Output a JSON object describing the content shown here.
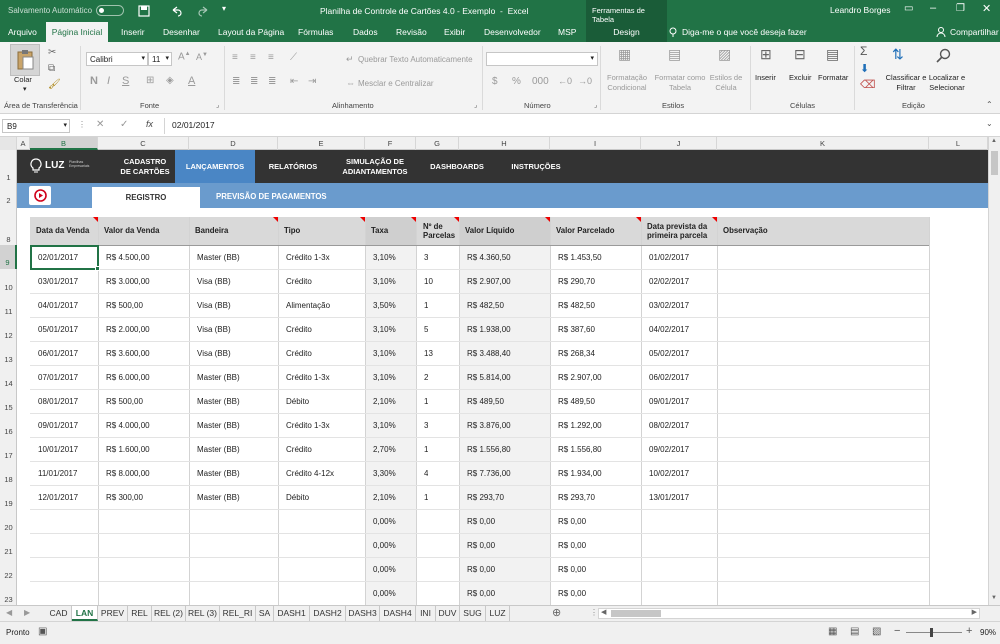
{
  "titlebar": {
    "autosave_label": "Salvamento Automático",
    "autosave_state": "Desativado",
    "title": "Planilha de Controle de Cartões 4.0 - Exemplo  -  Excel",
    "context_tools": "Ferramentas de Tabela",
    "user": "Leandro Borges"
  },
  "ribbon_tabs": [
    "Arquivo",
    "Página Inicial",
    "Inserir",
    "Desenhar",
    "Layout da Página",
    "Fórmulas",
    "Dados",
    "Revisão",
    "Exibir",
    "Desenvolvedor",
    "MSP",
    "Design"
  ],
  "tell_me": "Diga-me o que você deseja fazer",
  "share": "Compartilhar",
  "ribbon": {
    "paste": "Colar",
    "clipboard": "Área de Transferência",
    "font_name": "Calibri",
    "font_size": "11",
    "bold": "N",
    "italic": "I",
    "underline": "S",
    "font_group": "Fonte",
    "wrap_text": "Quebrar Texto Automaticamente",
    "merge_center": "Mesclar e Centralizar",
    "alignment_group": "Alinhamento",
    "number_group": "Número",
    "cond_format": "Formatação Condicional",
    "format_table": "Formatar como Tabela",
    "cell_styles": "Estilos de Célula",
    "styles_group": "Estilos",
    "insert": "Inserir",
    "delete": "Excluir",
    "format": "Formatar",
    "cells_group": "Células",
    "sort_filter": "Classificar e Filtrar",
    "find_select": "Localizar e Selecionar",
    "editing_group": "Edição"
  },
  "formula_bar": {
    "name_box": "B9",
    "formula": "02/01/2017",
    "fx": "fx"
  },
  "columns": [
    "A",
    "B",
    "C",
    "D",
    "E",
    "F",
    "G",
    "H",
    "I",
    "J",
    "K",
    "L"
  ],
  "rows": [
    "1",
    "2",
    "8",
    "9",
    "10",
    "11",
    "12",
    "13",
    "14",
    "15",
    "16",
    "17",
    "18",
    "19",
    "20",
    "21",
    "22",
    "23"
  ],
  "nav": {
    "logo": "LUZ",
    "logo_sub": "Planilhas Empresariais",
    "items": [
      "CADASTRO\nDE CARTÕES",
      "LANÇAMENTOS",
      "RELATÓRIOS",
      "SIMULAÇÃO DE\nADIANTAMENTOS",
      "DASHBOARDS",
      "INSTRUÇÕES"
    ],
    "active_index": 1
  },
  "subtabs": [
    "REGISTRO",
    "PREVISÃO DE PAGAMENTOS"
  ],
  "table": {
    "headers": [
      "Data da Venda",
      "Valor da Venda",
      "Bandeira",
      "Tipo",
      "Taxa",
      "Nº de Parcelas",
      "Valor Líquido",
      "Valor Parcelado",
      "Data prevista da primeira parcela",
      "Observação"
    ],
    "rows": [
      [
        "02/01/2017",
        "R$ 4.500,00",
        "Master (BB)",
        "Crédito 1-3x",
        "3,10%",
        "3",
        "R$ 4.360,50",
        "R$ 1.453,50",
        "01/02/2017",
        ""
      ],
      [
        "03/01/2017",
        "R$ 3.000,00",
        "Visa (BB)",
        "Crédito",
        "3,10%",
        "10",
        "R$ 2.907,00",
        "R$ 290,70",
        "02/02/2017",
        ""
      ],
      [
        "04/01/2017",
        "R$ 500,00",
        "Visa (BB)",
        "Alimentação",
        "3,50%",
        "1",
        "R$ 482,50",
        "R$ 482,50",
        "03/02/2017",
        ""
      ],
      [
        "05/01/2017",
        "R$ 2.000,00",
        "Visa (BB)",
        "Crédito",
        "3,10%",
        "5",
        "R$ 1.938,00",
        "R$ 387,60",
        "04/02/2017",
        ""
      ],
      [
        "06/01/2017",
        "R$ 3.600,00",
        "Visa (BB)",
        "Crédito",
        "3,10%",
        "13",
        "R$ 3.488,40",
        "R$ 268,34",
        "05/02/2017",
        ""
      ],
      [
        "07/01/2017",
        "R$ 6.000,00",
        "Master (BB)",
        "Crédito 1-3x",
        "3,10%",
        "2",
        "R$ 5.814,00",
        "R$ 2.907,00",
        "06/02/2017",
        ""
      ],
      [
        "08/01/2017",
        "R$ 500,00",
        "Master (BB)",
        "Débito",
        "2,10%",
        "1",
        "R$ 489,50",
        "R$ 489,50",
        "09/01/2017",
        ""
      ],
      [
        "09/01/2017",
        "R$ 4.000,00",
        "Master (BB)",
        "Crédito 1-3x",
        "3,10%",
        "3",
        "R$ 3.876,00",
        "R$ 1.292,00",
        "08/02/2017",
        ""
      ],
      [
        "10/01/2017",
        "R$ 1.600,00",
        "Master (BB)",
        "Crédito",
        "2,70%",
        "1",
        "R$ 1.556,80",
        "R$ 1.556,80",
        "09/02/2017",
        ""
      ],
      [
        "11/01/2017",
        "R$ 8.000,00",
        "Master (BB)",
        "Crédito 4-12x",
        "3,30%",
        "4",
        "R$ 7.736,00",
        "R$ 1.934,00",
        "10/02/2017",
        ""
      ],
      [
        "12/01/2017",
        "R$ 300,00",
        "Master (BB)",
        "Débito",
        "2,10%",
        "1",
        "R$ 293,70",
        "R$ 293,70",
        "13/01/2017",
        ""
      ],
      [
        "",
        "",
        "",
        "",
        "0,00%",
        "",
        "R$ 0,00",
        "R$ 0,00",
        "",
        ""
      ],
      [
        "",
        "",
        "",
        "",
        "0,00%",
        "",
        "R$ 0,00",
        "R$ 0,00",
        "",
        ""
      ],
      [
        "",
        "",
        "",
        "",
        "0,00%",
        "",
        "R$ 0,00",
        "R$ 0,00",
        "",
        ""
      ],
      [
        "",
        "",
        "",
        "",
        "0,00%",
        "",
        "R$ 0,00",
        "R$ 0,00",
        "",
        ""
      ]
    ]
  },
  "sheet_tabs": [
    "CAD",
    "LAN",
    "PREV",
    "REL",
    "REL (2)",
    "REL (3)",
    "REL_RI",
    "SA",
    "DASH1",
    "DASH2",
    "DASH3",
    "DASH4",
    "INI",
    "DUV",
    "SUG",
    "LUZ"
  ],
  "active_sheet": "LAN",
  "status": {
    "ready": "Pronto",
    "zoom": "90%"
  },
  "colors": {
    "excel_green": "#217346",
    "nav_dark": "#333333",
    "nav_active": "#4a86c5",
    "subband": "#6a9bcd"
  }
}
